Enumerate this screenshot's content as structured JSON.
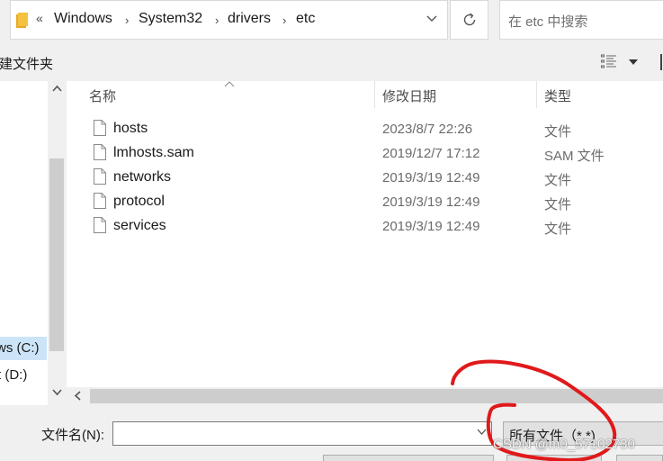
{
  "address_bar": {
    "overflow": "«",
    "breadcrumbs": [
      "Windows",
      "System32",
      "drivers",
      "etc"
    ]
  },
  "search": {
    "placeholder": "在 etc 中搜索"
  },
  "toolbar": {
    "new_folder": "建文件夹"
  },
  "nav": {
    "items": [
      {
        "label": "ws (C:)",
        "selected": true
      },
      {
        "label": "t (D:)",
        "selected": false
      }
    ]
  },
  "columns": {
    "name": "名称",
    "modified": "修改日期",
    "type": "类型"
  },
  "files": [
    {
      "name": "hosts",
      "modified": "2023/8/7 22:26",
      "type": "文件"
    },
    {
      "name": "lmhosts.sam",
      "modified": "2019/12/7 17:12",
      "type": "SAM 文件"
    },
    {
      "name": "networks",
      "modified": "2019/3/19 12:49",
      "type": "文件"
    },
    {
      "name": "protocol",
      "modified": "2019/3/19 12:49",
      "type": "文件"
    },
    {
      "name": "services",
      "modified": "2019/3/19 12:49",
      "type": "文件"
    }
  ],
  "bottom": {
    "filename_label": "文件名(N):",
    "filename_value": "",
    "filetype_selected": "所有文件（*.*)"
  },
  "watermark": "CSDN @m0_57102730",
  "icons": {
    "folder": "folder-icon",
    "refresh": "refresh-icon",
    "file": "file-icon",
    "view": "details-view-icon"
  },
  "colors": {
    "selection": "#cce4f7",
    "annotation_red": "#e0191b",
    "folder_yellow": "#f5c142"
  }
}
